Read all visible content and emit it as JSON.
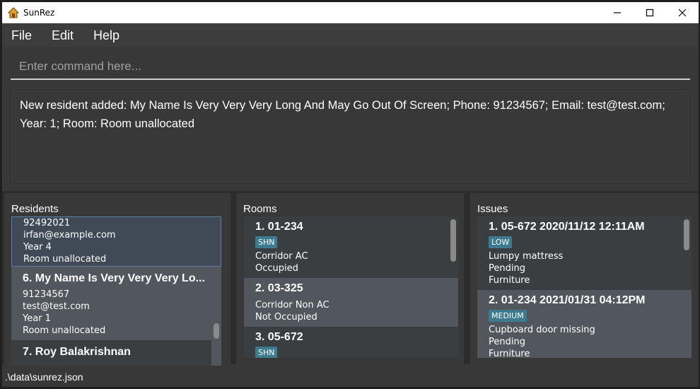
{
  "window": {
    "title": "SunRez"
  },
  "menu": {
    "items": [
      "File",
      "Edit",
      "Help"
    ]
  },
  "command": {
    "placeholder": "Enter command here..."
  },
  "result": {
    "text": "New resident added: My Name Is Very Very Very Long And May Go Out Of Screen; Phone: 91234567; Email: test@test.com; Year: 1; Room: Room unallocated"
  },
  "residents": {
    "title": "Residents",
    "cards": [
      {
        "lines": [
          "92492021",
          "irfan@example.com",
          "Year 4",
          "Room unallocated"
        ]
      },
      {
        "title": "6.  My Name Is Very Very Very Lo...",
        "lines": [
          "91234567",
          "test@test.com",
          "Year 1",
          "Room unallocated"
        ]
      },
      {
        "title": "7.  Roy Balakrishnan"
      }
    ]
  },
  "rooms": {
    "title": "Rooms",
    "cards": [
      {
        "title": "1.  01-234",
        "tag": "SHN",
        "lines": [
          "Corridor AC",
          "Occupied"
        ]
      },
      {
        "title": "2.  03-325",
        "lines": [
          "Corridor Non AC",
          "Not Occupied"
        ]
      },
      {
        "title": "3.  05-672",
        "tag": "SHN"
      }
    ]
  },
  "issues": {
    "title": "Issues",
    "cards": [
      {
        "title": "1.  05-672 2020/11/12 12:11AM",
        "tag": "LOW",
        "lines": [
          "Lumpy mattress",
          "Pending",
          "Furniture"
        ]
      },
      {
        "title": "2.  01-234 2021/01/31 04:12PM",
        "tag": "MEDIUM",
        "lines": [
          "Cupboard door missing",
          "Pending",
          "Furniture"
        ]
      }
    ]
  },
  "status": {
    "path": ".\\data\\sunrez.json"
  },
  "colors": {
    "tag": "#3e7b91",
    "background": "#383838",
    "selected_border": "#5a7fa7"
  }
}
